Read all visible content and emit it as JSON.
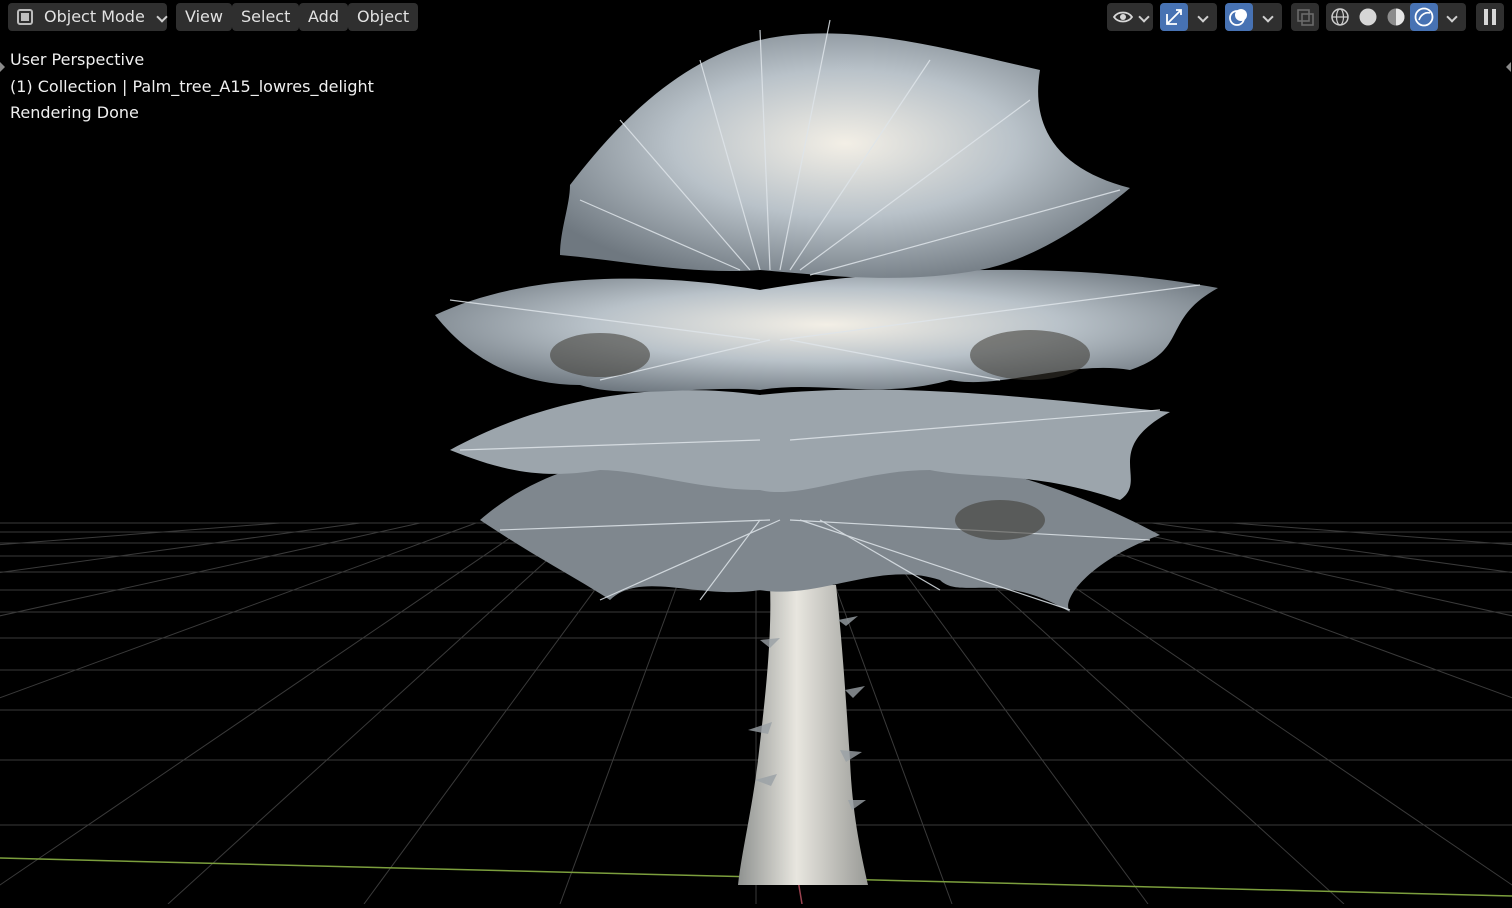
{
  "header": {
    "mode_label": "Object Mode",
    "menus": [
      "View",
      "Select",
      "Add",
      "Object"
    ]
  },
  "viewport": {
    "perspective": "User Perspective",
    "collection": "(1) Collection | Palm_tree_A15_lowres_delight",
    "status": "Rendering Done"
  },
  "toolbar_icons": [
    "visibility-eye-icon",
    "gizmo-icon",
    "overlays-icon",
    "xray-icon",
    "wireframe-shading-icon",
    "solid-shading-icon",
    "material-preview-icon",
    "rendered-shading-icon",
    "pause-render-icon"
  ],
  "colors": {
    "header_button": "#2f2f2f",
    "active_blue": "#4772b3",
    "grid_line": "#3a3a3a",
    "x_axis": "#9a4250",
    "y_axis": "#7c9f3d",
    "palm": "#c9d0d6"
  }
}
